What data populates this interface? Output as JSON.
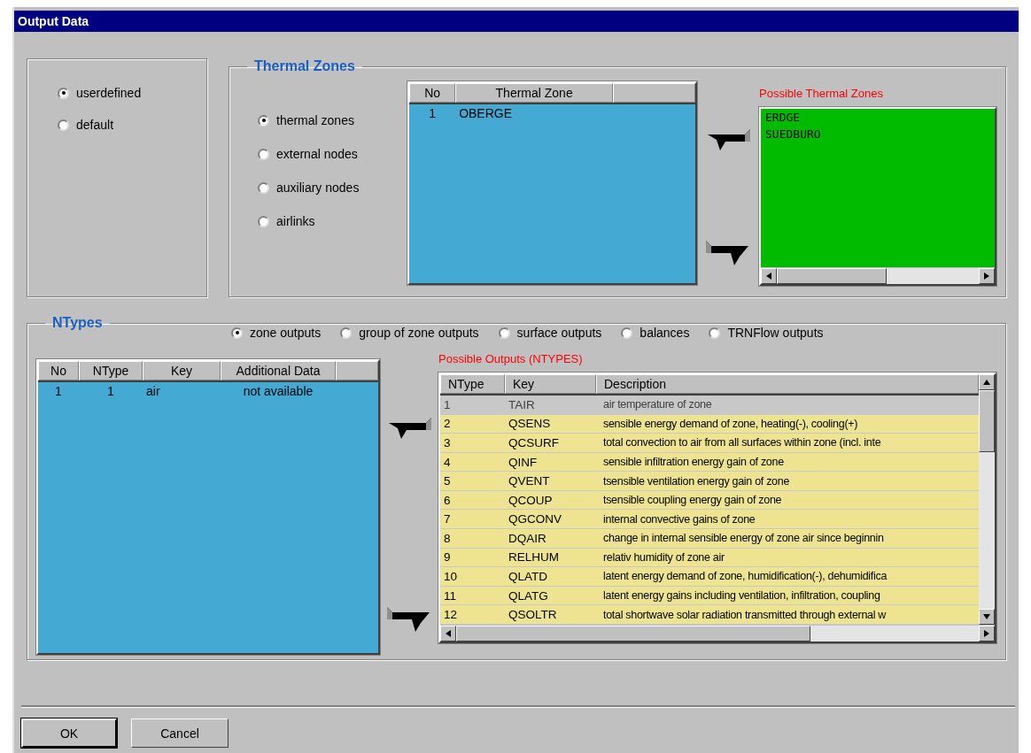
{
  "window": {
    "title": "Output Data"
  },
  "mode_options": [
    {
      "label": "userdefined",
      "selected": true
    },
    {
      "label": "default",
      "selected": false
    }
  ],
  "thermal_zones": {
    "title": "Thermal Zones",
    "node_types": [
      {
        "label": "thermal zones",
        "selected": true
      },
      {
        "label": "external nodes",
        "selected": false
      },
      {
        "label": "auxiliary nodes",
        "selected": false
      },
      {
        "label": "airlinks",
        "selected": false
      }
    ],
    "table": {
      "columns": [
        "No",
        "Thermal Zone"
      ],
      "rows": [
        {
          "no": "1",
          "zone": "OBERGE"
        }
      ]
    },
    "possible_label": "Possible Thermal Zones",
    "possible_zones": [
      "ERDGE",
      "SUEDBURO"
    ]
  },
  "ntypes": {
    "title": "NTypes",
    "output_types": [
      {
        "label": "zone outputs",
        "selected": true
      },
      {
        "label": "group of zone outputs",
        "selected": false
      },
      {
        "label": "surface outputs",
        "selected": false
      },
      {
        "label": "balances",
        "selected": false
      },
      {
        "label": "TRNFlow outputs",
        "selected": false
      }
    ],
    "table": {
      "columns": [
        "No",
        "NType",
        "Key",
        "Additional Data"
      ],
      "rows": [
        {
          "no": "1",
          "ntype": "1",
          "key": "air",
          "additional_data": "not available"
        }
      ]
    },
    "possible_label": "Possible Outputs (NTYPES)",
    "possible_table": {
      "columns": [
        "NType",
        "Key",
        "Description"
      ],
      "rows": [
        {
          "ntype": "1",
          "key": "TAIR",
          "description": "air temperature of zone",
          "selected": true
        },
        {
          "ntype": "2",
          "key": "QSENS",
          "description": "sensible energy demand of zone, heating(-), cooling(+)",
          "selected": false
        },
        {
          "ntype": "3",
          "key": "QCSURF",
          "description": "total convection to air from all surfaces within zone (incl. inte",
          "selected": false
        },
        {
          "ntype": "4",
          "key": "QINF",
          "description": "sensible infiltration energy gain of zone",
          "selected": false
        },
        {
          "ntype": "5",
          "key": "QVENT",
          "description": "tsensible ventilation energy gain of zone",
          "selected": false
        },
        {
          "ntype": "6",
          "key": "QCOUP",
          "description": "tsensible coupling energy gain of zone",
          "selected": false
        },
        {
          "ntype": "7",
          "key": "QGCONV",
          "description": "internal convective gains of zone",
          "selected": false
        },
        {
          "ntype": "8",
          "key": "DQAIR",
          "description": "change in internal sensible energy of zone air since beginnin",
          "selected": false
        },
        {
          "ntype": "9",
          "key": "RELHUM",
          "description": "relativ humidity of zone air",
          "selected": false
        },
        {
          "ntype": "10",
          "key": "QLATD",
          "description": "latent energy demand of zone, humidification(-), dehumidifica",
          "selected": false
        },
        {
          "ntype": "11",
          "key": "QLATG",
          "description": "latent energy gains including ventilation, infiltration, coupling",
          "selected": false
        },
        {
          "ntype": "12",
          "key": "QSOLTR",
          "description": "total shortwave solar radiation transmitted through external w",
          "selected": false
        }
      ]
    }
  },
  "buttons": [
    {
      "label": "OK",
      "default": true
    },
    {
      "label": "Cancel",
      "default": false
    }
  ]
}
